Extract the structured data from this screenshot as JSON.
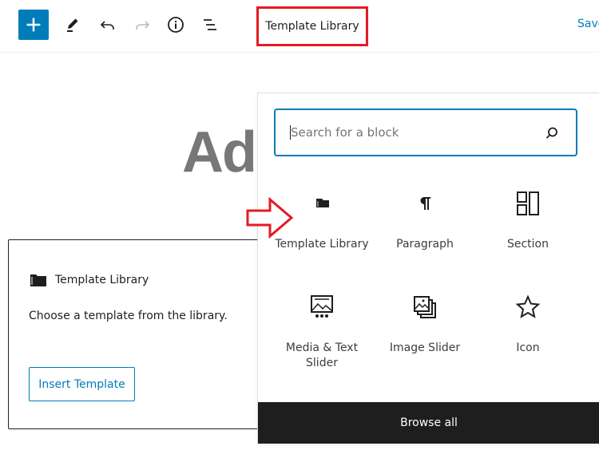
{
  "toolbar": {
    "add_block": "add-block",
    "document_title": "Template Library",
    "save_label": "Save"
  },
  "editor": {
    "post_title_fragment": "Ad"
  },
  "template_block": {
    "title": "Template Library",
    "description": "Choose a template from the library.",
    "insert_button": "Insert Template"
  },
  "inserter": {
    "search_placeholder": "Search for a block",
    "blocks": [
      {
        "label": "Template Library",
        "icon": "folder-icon"
      },
      {
        "label": "Paragraph",
        "icon": "pilcrow-icon"
      },
      {
        "label": "Section",
        "icon": "columns-icon"
      },
      {
        "label": "Media & Text Slider",
        "icon": "media-slider-icon"
      },
      {
        "label": "Image Slider",
        "icon": "gallery-icon"
      },
      {
        "label": "Icon",
        "icon": "star-icon"
      }
    ],
    "browse_all": "Browse all"
  },
  "colors": {
    "accent": "#007cba",
    "annotation_red": "#e31b23",
    "dark": "#1e1e1e"
  }
}
